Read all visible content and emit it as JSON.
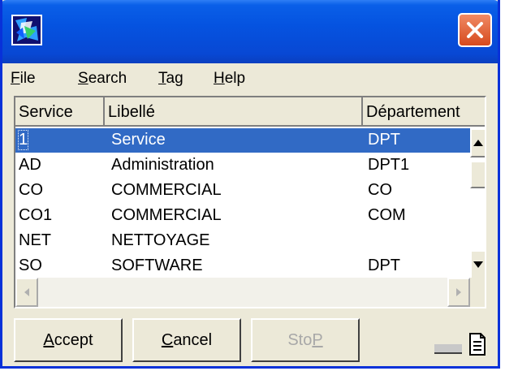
{
  "menu": {
    "items": [
      {
        "label": "File",
        "accel": "F",
        "rest": "ile"
      },
      {
        "label": "Search",
        "accel": "S",
        "rest": "earch"
      },
      {
        "label": "Tag",
        "accel": "T",
        "rest": "ag"
      },
      {
        "label": "Help",
        "accel": "H",
        "rest": "elp"
      }
    ]
  },
  "grid": {
    "columns": [
      "Service",
      "Libellé",
      "Département"
    ],
    "rows": [
      {
        "service": "1",
        "libelle": "Service",
        "departement": "DPT",
        "selected": true
      },
      {
        "service": "AD",
        "libelle": "Administration",
        "departement": "DPT1"
      },
      {
        "service": "CO",
        "libelle": "COMMERCIAL",
        "departement": "CO"
      },
      {
        "service": "CO1",
        "libelle": "COMMERCIAL",
        "departement": "COM"
      },
      {
        "service": "NET",
        "libelle": "NETTOYAGE",
        "departement": ""
      },
      {
        "service": "SO",
        "libelle": "SOFTWARE",
        "departement": "DPT"
      }
    ]
  },
  "buttons": {
    "accept": {
      "accel": "A",
      "rest": "ccept"
    },
    "cancel": {
      "accel": "C",
      "rest": "ancel"
    },
    "stop": {
      "pre": "Sto",
      "accel": "P"
    }
  },
  "icons": {
    "app": "app-logo-icon",
    "close": "close-icon",
    "document": "document-icon"
  },
  "colors": {
    "title_bar": "#0553e0",
    "close_button": "#d64a1e",
    "selection": "#316ac5",
    "face": "#ece9d8"
  }
}
